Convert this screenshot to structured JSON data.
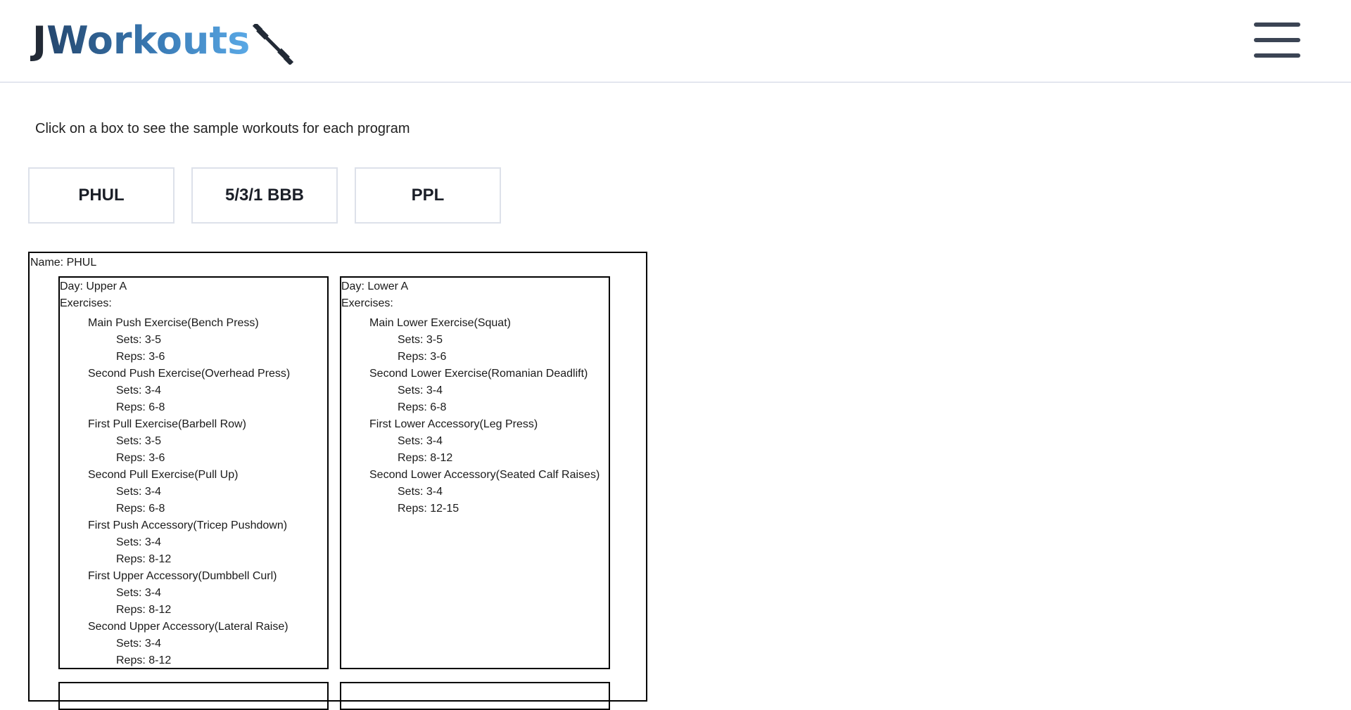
{
  "header": {
    "logo_j": "J",
    "logo_rest": "Workouts",
    "logo_icon": "dumbbell-icon",
    "menu_icon": "hamburger-menu-icon"
  },
  "intro": "Click on a box to see the sample workouts for each program",
  "programs": [
    "PHUL",
    "5/3/1 BBB",
    "PPL"
  ],
  "selected_program": {
    "name_label": "Name: PHUL",
    "days": [
      {
        "day_label": "Day: Upper A",
        "exercises_label": "Exercises:",
        "exercises": [
          {
            "name": "Main Push Exercise(Bench Press)",
            "sets": "Sets: 3-5",
            "reps": "Reps: 3-6"
          },
          {
            "name": "Second Push Exercise(Overhead Press)",
            "sets": "Sets: 3-4",
            "reps": "Reps: 6-8"
          },
          {
            "name": "First Pull Exercise(Barbell Row)",
            "sets": "Sets: 3-5",
            "reps": "Reps: 3-6"
          },
          {
            "name": "Second Pull Exercise(Pull Up)",
            "sets": "Sets: 3-4",
            "reps": "Reps: 6-8"
          },
          {
            "name": "First Push Accessory(Tricep Pushdown)",
            "sets": "Sets: 3-4",
            "reps": "Reps: 8-12"
          },
          {
            "name": "First Upper Accessory(Dumbbell Curl)",
            "sets": "Sets: 3-4",
            "reps": "Reps: 8-12"
          },
          {
            "name": "Second Upper Accessory(Lateral Raise)",
            "sets": "Sets: 3-4",
            "reps": "Reps: 8-12"
          }
        ]
      },
      {
        "day_label": "Day: Lower A",
        "exercises_label": "Exercises:",
        "exercises": [
          {
            "name": "Main Lower Exercise(Squat)",
            "sets": "Sets: 3-5",
            "reps": "Reps: 3-6"
          },
          {
            "name": "Second Lower Exercise(Romanian Deadlift)",
            "sets": "Sets: 3-4",
            "reps": "Reps: 6-8"
          },
          {
            "name": "First Lower Accessory(Leg Press)",
            "sets": "Sets: 3-4",
            "reps": "Reps: 8-12"
          },
          {
            "name": "Second Lower Accessory(Seated Calf Raises)",
            "sets": "Sets: 3-4",
            "reps": "Reps: 12-15"
          }
        ]
      }
    ]
  }
}
